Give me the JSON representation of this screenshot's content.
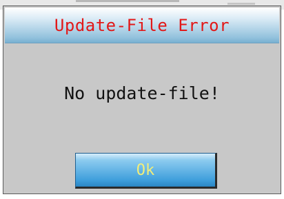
{
  "dialog": {
    "title": "Update-File Error",
    "message": "No update-file!",
    "ok_label": "Ok"
  },
  "colors": {
    "title_text": "#e21818",
    "ok_text": "#f2ee7a",
    "dialog_background": "#c8c8c8",
    "button_blue": "#3f9fdc"
  }
}
